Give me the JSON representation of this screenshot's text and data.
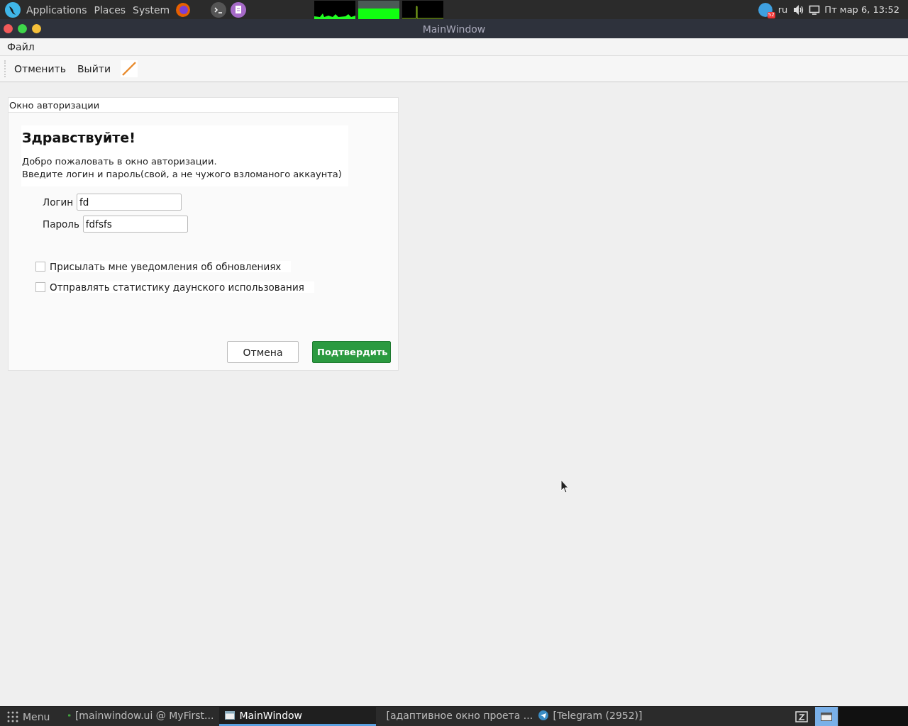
{
  "top_panel": {
    "menus": [
      "Applications",
      "Places",
      "System"
    ],
    "tray": {
      "badge": "52",
      "keyboard_layout": "ru",
      "clock": "Пт мар  6, 13:52"
    }
  },
  "window": {
    "title": "MainWindow"
  },
  "menu_bar": [
    "Файл"
  ],
  "toolbar": [
    "Отменить",
    "Выйти"
  ],
  "group_box": {
    "title": "Окно авторизации",
    "heading": "Здравствуйте!",
    "description": [
      "Добро пожаловать в окно авторизации.",
      "Введите логин и пароль(свой, а не чужого взломаного аккаунта)"
    ],
    "fields": [
      {
        "label": "Логин",
        "value": "fd"
      },
      {
        "label": "Пароль",
        "value": "fdfsfs"
      }
    ],
    "checkboxes": [
      {
        "label": "Присылать мне уведомления об обновлениях",
        "checked": false
      },
      {
        "label": "Отправлять статистику даунского использования",
        "checked": false
      }
    ],
    "buttons": [
      {
        "label": "Отмена",
        "kind": "secondary"
      },
      {
        "label": "Подтвердить",
        "kind": "primary"
      }
    ]
  },
  "taskbar": {
    "menu": "Menu",
    "items": [
      {
        "label": "[mainwindow.ui @ MyFirst...",
        "kind": "qt",
        "selected": false
      },
      {
        "label": "MainWindow",
        "kind": "window",
        "selected": true
      },
      {
        "label": "[адаптивное окно проета ...",
        "kind": "browser",
        "selected": false
      },
      {
        "label": "[Telegram (2952)]",
        "kind": "telegram",
        "selected": false
      }
    ]
  }
}
